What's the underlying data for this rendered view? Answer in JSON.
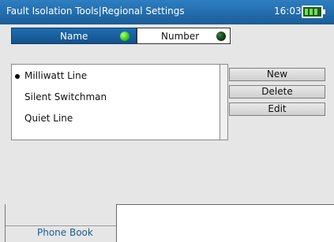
{
  "titlebar": {
    "title": "Fault Isolation Tools|Regional Settings",
    "time": "16:03"
  },
  "sort_toggle": {
    "name_label": "Name",
    "number_label": "Number",
    "selected": "Name"
  },
  "list": {
    "items": [
      {
        "label": "Milliwatt Line",
        "selected": true
      },
      {
        "label": "Silent Switchman",
        "selected": false
      },
      {
        "label": "Quiet Line",
        "selected": false
      }
    ]
  },
  "actions": {
    "new_label": "New",
    "delete_label": "Delete",
    "edit_label": "Edit"
  },
  "tabs": [
    {
      "label": "Phone Book",
      "active": true
    }
  ],
  "colors": {
    "titlebar": "#1f6fb0",
    "active_led": "#3bd11b",
    "inactive_led": "#0e3a0e",
    "tab_text": "#1b5d98"
  },
  "battery": {
    "icon": "battery-icon",
    "level": 1.0
  }
}
